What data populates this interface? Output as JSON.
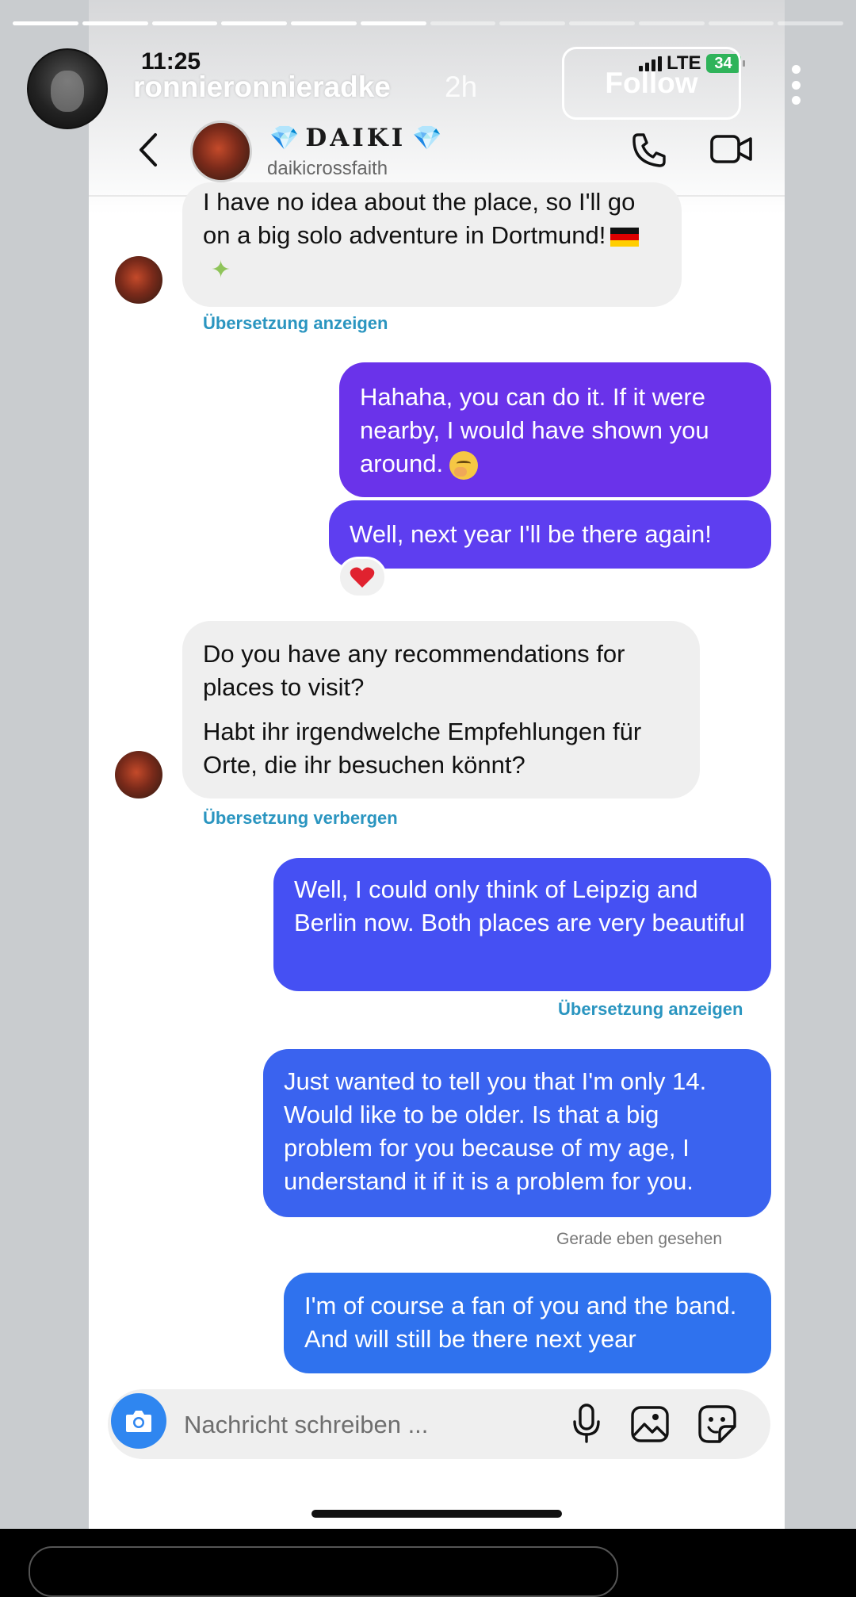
{
  "story": {
    "time": "11:25",
    "username": "ronnieronnieradke",
    "age": "2h",
    "follow_label": "Follow",
    "progress": {
      "segments": 12,
      "completed": 6
    },
    "status": {
      "network": "LTE",
      "battery": "34"
    }
  },
  "chat": {
    "name": "DAIKI",
    "name_emoji": "💎",
    "handle": "daikicrossfaith",
    "accent_colors": [
      "#6a33ea",
      "#4550f3",
      "#2f72ee"
    ]
  },
  "messages": {
    "m1": "I have no idea about the place, so I'll go on a big solo adventure in Dortmund!",
    "m1_link": "Übersetzung anzeigen",
    "m2": "Hahaha, you can do it. If it were nearby, I would have shown you around.",
    "m3": "Well, next year I'll be there again!",
    "m3_reaction": "❤️",
    "m4_text": "Do you have any recommendations for places to visit?",
    "m4_translation": "Habt ihr irgendwelche Empfehlungen für Orte, die ihr besuchen könnt?",
    "m4_link": "Übersetzung verbergen",
    "m5": "Well, I could only think of Leipzig and Berlin now. Both places are very beautiful",
    "m5_link": "Übersetzung anzeigen",
    "m6": "Just wanted to tell you that I'm only 14. Would like to be older. Is that a big problem for you because of my age, I understand it if it is a problem for you.",
    "seen": "Gerade eben gesehen",
    "m7": "I'm of course a fan of you and the band. And will still be there next year"
  },
  "composer": {
    "placeholder": "Nachricht schreiben ..."
  }
}
